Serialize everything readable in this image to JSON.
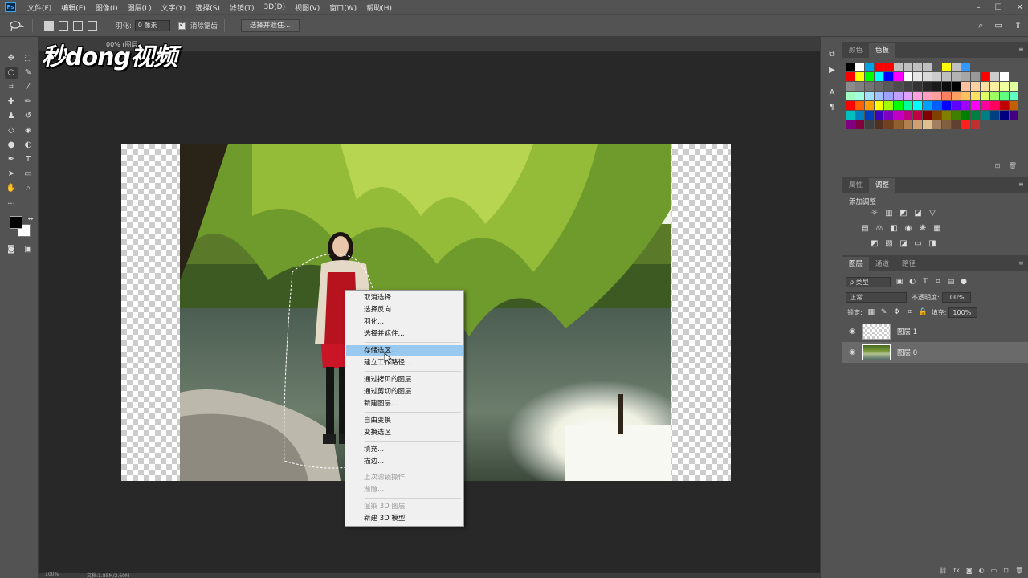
{
  "menubar": {
    "logo": "Ps",
    "items": [
      "文件(F)",
      "编辑(E)",
      "图像(I)",
      "图层(L)",
      "文字(Y)",
      "选择(S)",
      "滤镜(T)",
      "3D(D)",
      "视图(V)",
      "窗口(W)",
      "帮助(H)"
    ],
    "window_controls": [
      "–",
      "☐",
      "✕"
    ]
  },
  "options": {
    "feather_label": "羽化:",
    "feather_value": "0 像素",
    "antialias_label": "消除锯齿",
    "select_mask_button": "选择并遮住..."
  },
  "document": {
    "tab_label": "00% (图层",
    "watermark": "秒dong视频",
    "status_zoom": "100%",
    "status_doc": "文档:1.85M/2.60M"
  },
  "context_menu": {
    "items": [
      {
        "label": "取消选择",
        "state": "normal"
      },
      {
        "label": "选择反向",
        "state": "normal"
      },
      {
        "label": "羽化...",
        "state": "normal"
      },
      {
        "label": "选择并遮住...",
        "state": "normal"
      },
      {
        "label": "存储选区...",
        "state": "highlighted"
      },
      {
        "label": "建立工作路径...",
        "state": "normal"
      },
      {
        "label": "通过拷贝的图层",
        "state": "normal"
      },
      {
        "label": "通过剪切的图层",
        "state": "normal"
      },
      {
        "label": "新建图层...",
        "state": "normal"
      },
      {
        "label": "自由变换",
        "state": "normal"
      },
      {
        "label": "变换选区",
        "state": "normal"
      },
      {
        "label": "填充...",
        "state": "normal"
      },
      {
        "label": "描边...",
        "state": "normal"
      },
      {
        "label": "上次滤镜操作",
        "state": "disabled"
      },
      {
        "label": "渐隐...",
        "state": "disabled"
      },
      {
        "label": "渲染 3D 图层",
        "state": "disabled"
      },
      {
        "label": "新建 3D 模型",
        "state": "normal"
      }
    ]
  },
  "swatch_panel": {
    "tabs": [
      "颜色",
      "色板"
    ],
    "active_tab": "色板",
    "rows": [
      [
        "#000000",
        "#ffffff",
        "#00a2e8",
        "#ff0000",
        "#ff0000",
        "#c0c0c0",
        "#c0c0c0",
        "#c0c0c0",
        "#c0c0c0",
        "#535353",
        "#ffff00",
        "#c0c0c0",
        "#3399ff",
        "#535353"
      ],
      [
        "#ff0000",
        "#ffff00",
        "#00ff00",
        "#00ffff",
        "#0000ff",
        "#ff00ff",
        "#ffffff",
        "#e6e6e6",
        "#d9d9d9",
        "#cccccc",
        "#bfbfbf",
        "#b3b3b3",
        "#a6a6a6",
        "#999999",
        "#ff0000",
        "#cccccc",
        "#ffffff"
      ],
      [
        "#8c8c8c",
        "#808080",
        "#737373",
        "#666666",
        "#595959",
        "#4d4d4d",
        "#404040",
        "#333333",
        "#262626",
        "#1a1a1a",
        "#0d0d0d",
        "#000000",
        "#ffc0a0",
        "#ffd0a0",
        "#ffe0a0",
        "#fff0a0",
        "#f0ffa0",
        "#e0ffa0"
      ],
      [
        "#a0ffc0",
        "#a0ffe0",
        "#a0e0ff",
        "#a0c0ff",
        "#a0a0ff",
        "#c0a0ff",
        "#e0a0ff",
        "#ffa0e0",
        "#ffa0c0",
        "#ffa0a0",
        "#ff8060",
        "#ffa060",
        "#ffc060",
        "#ffe060",
        "#e0ff60",
        "#a0ff60",
        "#60ff80",
        "#60ffc0"
      ],
      [
        "#ff0000",
        "#ff6000",
        "#ffa000",
        "#ffff00",
        "#a0ff00",
        "#00ff00",
        "#00ffa0",
        "#00ffff",
        "#00a0ff",
        "#0060ff",
        "#0000ff",
        "#6000ff",
        "#a000ff",
        "#ff00ff",
        "#ff00a0",
        "#ff0060",
        "#c00000",
        "#c06000"
      ],
      [
        "#00c0c0",
        "#0080c0",
        "#0040c0",
        "#4000c0",
        "#8000c0",
        "#c000c0",
        "#c00080",
        "#c00040",
        "#800000",
        "#804000",
        "#808000",
        "#408000",
        "#008000",
        "#008040",
        "#008080",
        "#004080",
        "#000080",
        "#400080"
      ],
      [
        "#800080",
        "#800040",
        "#404040",
        "#503020",
        "#704020",
        "#906030",
        "#b08050",
        "#d0a070",
        "#e0c090",
        "#a08060",
        "#806040",
        "#604030",
        "#ff2020",
        "#c03030"
      ]
    ]
  },
  "adjustments_panel": {
    "tabs": [
      "属性",
      "调整"
    ],
    "active_tab": "调整",
    "label": "添加调整"
  },
  "layers_panel": {
    "tabs": [
      "图层",
      "通道",
      "路径"
    ],
    "active_tab": "图层",
    "filter_label": "ρ 类型",
    "blend_mode": "正常",
    "opacity_label": "不透明度:",
    "opacity_value": "100%",
    "lock_label": "锁定:",
    "fill_label": "填充:",
    "fill_value": "100%",
    "layers": [
      {
        "name": "图层 1",
        "thumb": "transparent",
        "selected": false
      },
      {
        "name": "图层 0",
        "thumb": "photo",
        "selected": true
      }
    ]
  },
  "colors": {
    "highlight": "#99c9ef",
    "ui_dark": "#535353",
    "canvas_bg": "#282828"
  }
}
